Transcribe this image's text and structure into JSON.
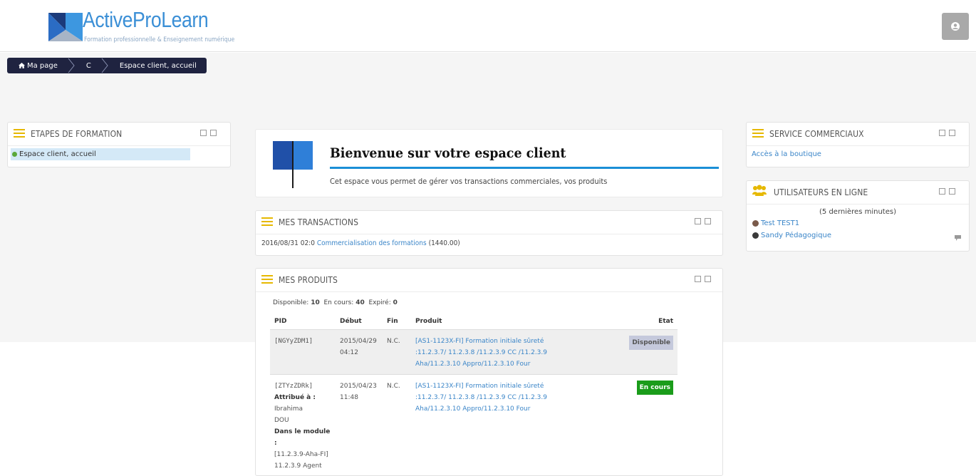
{
  "header": {
    "logo_title": "ActiveProLearn",
    "logo_subtitle": "Formation professionnelle & Enseignement numérique"
  },
  "breadcrumb": [
    {
      "label": "Ma page",
      "icon": "home-icon"
    },
    {
      "label": "C"
    },
    {
      "label": "Espace client, accueil"
    }
  ],
  "etapes": {
    "title": "ETAPES DE FORMATION",
    "item": "Espace client, accueil"
  },
  "welcome": {
    "title": "Bienvenue sur votre espace client",
    "text": "Cet espace vous permet de gérer vos transactions commerciales, vos produits"
  },
  "transactions": {
    "title": "MES TRANSACTIONS",
    "row": {
      "date": "2016/08/31 02:0",
      "link": "Commercialisation des formations",
      "amount": "(1440.00)"
    }
  },
  "produits": {
    "title": "MES PRODUITS",
    "summary": {
      "disponible_label": "Disponible:",
      "disponible_value": "10",
      "encours_label": "En cours:",
      "encours_value": "40",
      "expire_label": "Expiré:",
      "expire_value": "0"
    },
    "columns": [
      "PID",
      "Début",
      "Fin",
      "Produit",
      "Etat"
    ],
    "rows": [
      {
        "pid": "[NGYyZDM1]",
        "debut_date": "2015/04/29",
        "debut_time": "04:12",
        "fin": "N.C.",
        "produit": [
          "[AS1-1123X-FI] Formation initiale sûreté",
          ":11.2.3.7/ 11.2.3.8 /11.2.3.9 CC /11.2.3.9",
          "Aha/11.2.3.10 Appro/11.2.3.10 Four"
        ],
        "etat": "Disponible"
      },
      {
        "pid": "[ZTYzZDRk]",
        "attribue_label": "Attribué à :",
        "attribue_lines": [
          "Ibrahima",
          "DOU"
        ],
        "module_label": "Dans le module :",
        "module_lines": [
          "[11.2.3.9-Aha-FI]",
          "11.2.3.9 Agent"
        ],
        "debut_date": "2015/04/23",
        "debut_time": "11:48",
        "fin": "N.C.",
        "produit": [
          "[AS1-1123X-FI] Formation initiale sûreté",
          ":11.2.3.7/ 11.2.3.8 /11.2.3.9 CC /11.2.3.9",
          "Aha/11.2.3.10 Appro/11.2.3.10 Four"
        ],
        "etat": "En cours"
      }
    ]
  },
  "service": {
    "title": "SERVICE COMMERCIAUX",
    "link": "Accès à la boutique"
  },
  "online": {
    "title": "UTILISATEURS EN LIGNE",
    "subtitle": "(5 dernières minutes)",
    "users": [
      "Test TEST1",
      "Sandy Pédagogique"
    ]
  },
  "colors": {
    "accent": "#1a8fd6",
    "link": "#3a85c8",
    "breadcrumb_bg": "#1f2340",
    "burger": "#e6b800",
    "disponible_bg": "#c5c9dc",
    "encours_bg": "#1a9c1a"
  }
}
